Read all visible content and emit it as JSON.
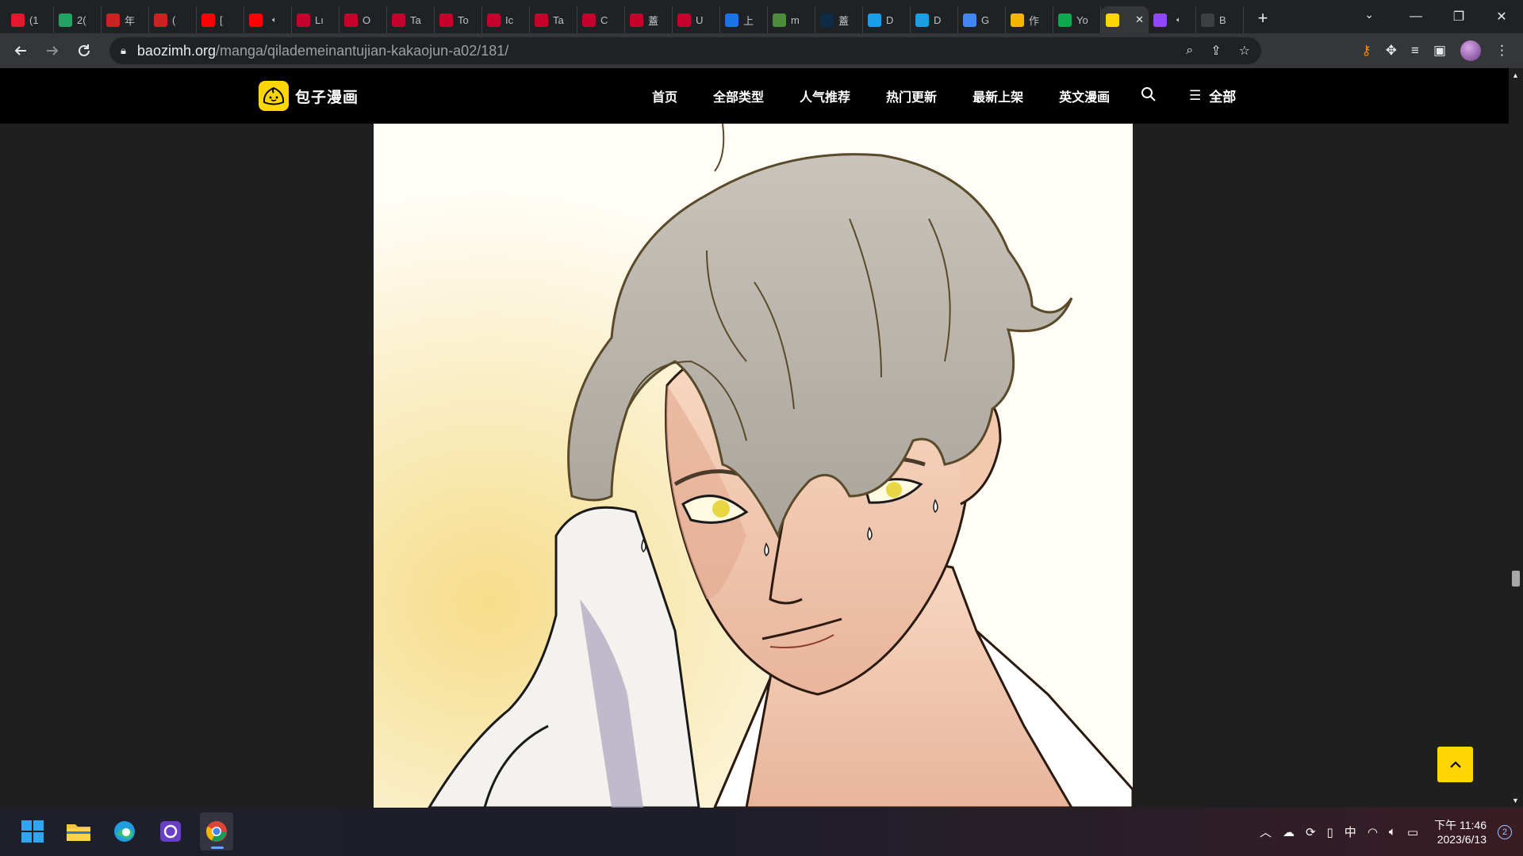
{
  "browser": {
    "tabs": [
      {
        "title": "(1",
        "favicon": "weibo-favicon",
        "color": "#e6162d"
      },
      {
        "title": "2(",
        "favicon": "drive-favicon",
        "color": "#1fa463"
      },
      {
        "title": "年",
        "favicon": "red-seal-favicon",
        "color": "#cc2222"
      },
      {
        "title": "(",
        "favicon": "red-seal-favicon",
        "color": "#cc2222"
      },
      {
        "title": "[",
        "favicon": "youtube-favicon",
        "color": "#ff0000"
      },
      {
        "title": "",
        "favicon": "youtube-favicon",
        "color": "#ff0000",
        "muted": true
      },
      {
        "title": "Lı",
        "favicon": "n-favicon",
        "color": "#c4002b"
      },
      {
        "title": "O",
        "favicon": "n-favicon",
        "color": "#c4002b"
      },
      {
        "title": "Ta",
        "favicon": "n-favicon",
        "color": "#c4002b"
      },
      {
        "title": "To",
        "favicon": "n-favicon",
        "color": "#c4002b"
      },
      {
        "title": "Ic",
        "favicon": "n-favicon",
        "color": "#c4002b"
      },
      {
        "title": "Ta",
        "favicon": "n-favicon",
        "color": "#c4002b"
      },
      {
        "title": "C",
        "favicon": "n-favicon",
        "color": "#c4002b"
      },
      {
        "title": "蓋",
        "favicon": "n-favicon",
        "color": "#c4002b"
      },
      {
        "title": "U",
        "favicon": "n-favicon",
        "color": "#c4002b"
      },
      {
        "title": "上",
        "favicon": "s-favicon",
        "color": "#1a73e8"
      },
      {
        "title": "m",
        "favicon": "frog-favicon",
        "color": "#4c8c3a"
      },
      {
        "title": "蓋",
        "favicon": "dl-favicon",
        "color": "#0f2b46"
      },
      {
        "title": "D",
        "favicon": "d-favicon",
        "color": "#1a9ee8"
      },
      {
        "title": "D",
        "favicon": "d-favicon",
        "color": "#1a9ee8"
      },
      {
        "title": "G",
        "favicon": "translate-favicon",
        "color": "#4285f4"
      },
      {
        "title": "作",
        "favicon": "tri-favicon",
        "color": "#f4b400"
      },
      {
        "title": "Yo",
        "favicon": "green-favicon",
        "color": "#0ea84f"
      },
      {
        "title": "",
        "favicon": "baozi-favicon",
        "color": "#ffd503",
        "active": true
      },
      {
        "title": "",
        "favicon": "twitch-favicon",
        "color": "#9146ff",
        "muted": true
      },
      {
        "title": "B",
        "favicon": "blank-favicon",
        "color": "#3c4043"
      }
    ],
    "url_host": "baozimh.org",
    "url_path": "/manga/qilademeinantujian-kakaojun-a02/181/"
  },
  "site": {
    "nav": [
      "首页",
      "全部类型",
      "人气推荐",
      "热门更新",
      "最新上架",
      "英文漫画"
    ],
    "menu_label": "全部",
    "logo_text": "包子漫画",
    "accent": "#ffd503"
  },
  "taskbar": {
    "ime": "中",
    "time": "下午 11:46",
    "date": "2023/6/13",
    "notifications": "2"
  }
}
